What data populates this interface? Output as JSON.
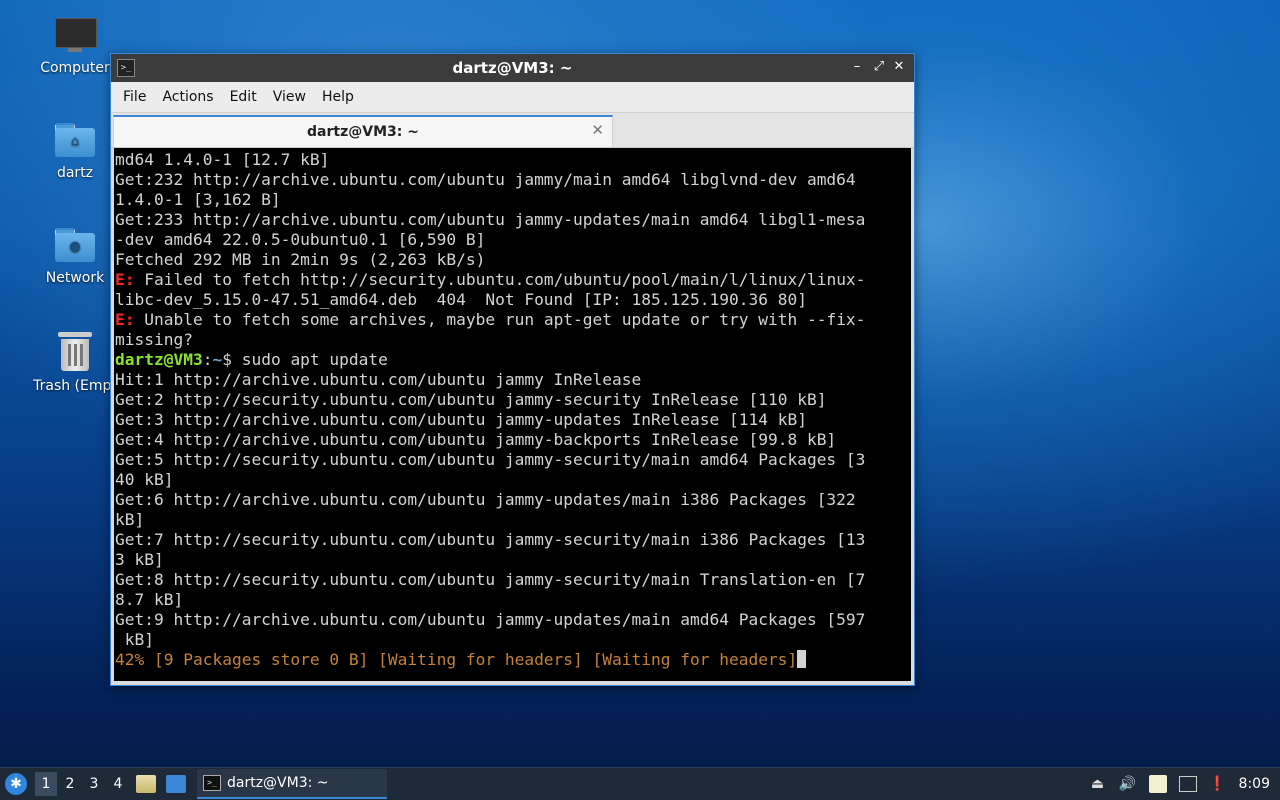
{
  "desktop": {
    "icons": [
      {
        "label": "Computer",
        "icon": "computer-icon"
      },
      {
        "label": "dartz",
        "icon": "home-folder-icon"
      },
      {
        "label": "Network",
        "icon": "network-folder-icon"
      },
      {
        "label": "Trash (Empt",
        "icon": "trash-icon"
      }
    ]
  },
  "window": {
    "title": "dartz@VM3: ~",
    "controls": {
      "minimize": "–",
      "maximize": "⤢",
      "close": "✕"
    },
    "menu": [
      "File",
      "Actions",
      "Edit",
      "View",
      "Help"
    ],
    "tab": {
      "title": "dartz@VM3: ~",
      "close": "✕"
    }
  },
  "terminal": {
    "lines": [
      {
        "text": "md64 1.4.0-1 [12.7 kB]"
      },
      {
        "text": "Get:232 http://archive.ubuntu.com/ubuntu jammy/main amd64 libglvnd-dev amd64"
      },
      {
        "text": "1.4.0-1 [3,162 B]"
      },
      {
        "text": "Get:233 http://archive.ubuntu.com/ubuntu jammy-updates/main amd64 libgl1-mesa"
      },
      {
        "text": "-dev amd64 22.0.5-0ubuntu0.1 [6,590 B]"
      },
      {
        "text": "Fetched 292 MB in 2min 9s (2,263 kB/s)"
      },
      {
        "prefix": "E:",
        "text": " Failed to fetch http://security.ubuntu.com/ubuntu/pool/main/l/linux/linux-"
      },
      {
        "text": "libc-dev_5.15.0-47.51_amd64.deb  404  Not Found [IP: 185.125.190.36 80]"
      },
      {
        "prefix": "E:",
        "text": " Unable to fetch some archives, maybe run apt-get update or try with --fix-"
      },
      {
        "text": "missing?"
      },
      {
        "prompt_user": "dartz@VM3",
        "prompt_sep": ":",
        "prompt_path": "~",
        "text": "$ sudo apt update"
      },
      {
        "text": "Hit:1 http://archive.ubuntu.com/ubuntu jammy InRelease"
      },
      {
        "text": "Get:2 http://security.ubuntu.com/ubuntu jammy-security InRelease [110 kB]"
      },
      {
        "text": "Get:3 http://archive.ubuntu.com/ubuntu jammy-updates InRelease [114 kB]"
      },
      {
        "text": "Get:4 http://archive.ubuntu.com/ubuntu jammy-backports InRelease [99.8 kB]"
      },
      {
        "text": "Get:5 http://security.ubuntu.com/ubuntu jammy-security/main amd64 Packages [3"
      },
      {
        "text": "40 kB]"
      },
      {
        "text": "Get:6 http://archive.ubuntu.com/ubuntu jammy-updates/main i386 Packages [322"
      },
      {
        "text": "kB]"
      },
      {
        "text": "Get:7 http://security.ubuntu.com/ubuntu jammy-security/main i386 Packages [13"
      },
      {
        "text": "3 kB]"
      },
      {
        "text": "Get:8 http://security.ubuntu.com/ubuntu jammy-security/main Translation-en [7"
      },
      {
        "text": "8.7 kB]"
      },
      {
        "text": "Get:9 http://archive.ubuntu.com/ubuntu jammy-updates/main amd64 Packages [597"
      },
      {
        "text": " kB]"
      }
    ],
    "progress_line": "42% [9 Packages store 0 B] [Waiting for headers] [Waiting for headers]"
  },
  "taskbar": {
    "workspaces": [
      "1",
      "2",
      "3",
      "4"
    ],
    "active_workspace": "1",
    "task_label": "dartz@VM3: ~",
    "clock": "8:09"
  }
}
